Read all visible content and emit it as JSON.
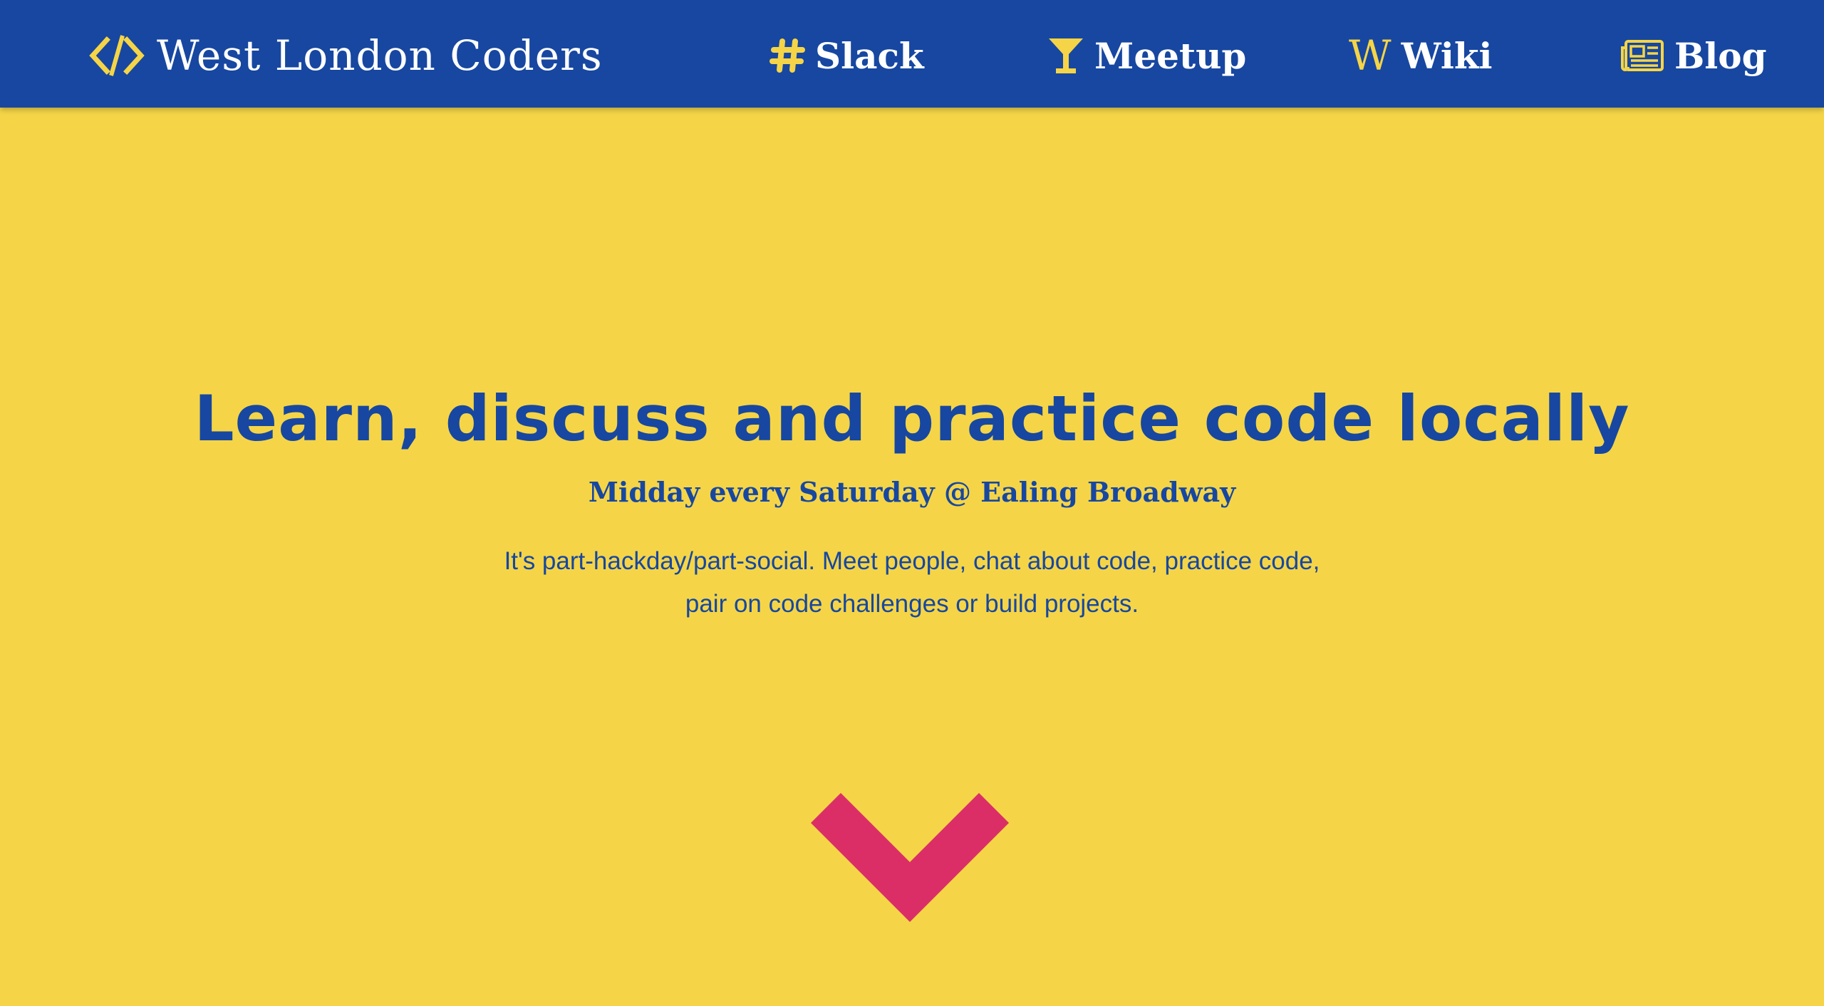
{
  "navbar": {
    "brand": {
      "icon": "code-icon",
      "title": "West London Coders"
    },
    "items": [
      {
        "icon": "hashtag-icon",
        "label": "Slack"
      },
      {
        "icon": "cocktail-glass-icon",
        "label": "Meetup"
      },
      {
        "icon": "wikipedia-w-icon",
        "icon_text": "W",
        "label": "Wiki"
      },
      {
        "icon": "newspaper-icon",
        "label": "Blog"
      }
    ]
  },
  "hero": {
    "title": "Learn, discuss and practice code locally",
    "subtitle": "Midday every Saturday @ Ealing Broadway",
    "description": "It's part-hackday/part-social. Meet people, chat about code, practice code, pair on code challenges or build projects.",
    "scroll_icon": "chevron-down-icon"
  },
  "colors": {
    "navbar_bg": "#1747a0",
    "page_bg": "#f5d547",
    "accent_yellow": "#f5d547",
    "text_blue": "#1747a0",
    "arrow_pink": "#db2e67"
  }
}
